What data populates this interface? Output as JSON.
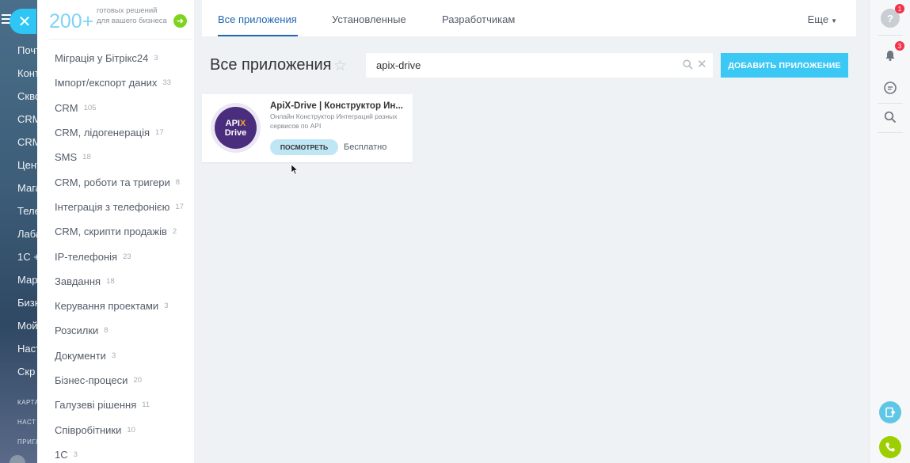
{
  "underlying_menu": {
    "items": [
      "Почт",
      "Конт",
      "Скво",
      "CRM",
      "CRM",
      "Цент",
      "Мага",
      "Теле",
      "Лаба",
      "1С +",
      "Мар",
      "Бизн",
      "Мой",
      "Наст",
      "Скр"
    ],
    "small_items": [
      "КАРТА",
      "НАСТ",
      "ПРИГЛ"
    ]
  },
  "promo": {
    "number": "200+",
    "text": "готовых решений для вашего бизнеса"
  },
  "categories": [
    {
      "label": "Міграція у Бітрікс24",
      "count": "3"
    },
    {
      "label": "Імпорт/експорт даних",
      "count": "33"
    },
    {
      "label": "CRM",
      "count": "105"
    },
    {
      "label": "CRM, лідогенерація",
      "count": "17"
    },
    {
      "label": "SMS",
      "count": "18"
    },
    {
      "label": "CRM, роботи та тригери",
      "count": "8"
    },
    {
      "label": "Інтеграція з телефонією",
      "count": "17"
    },
    {
      "label": "CRM, скрипти продажів",
      "count": "2"
    },
    {
      "label": "IP-телефонія",
      "count": "23"
    },
    {
      "label": "Завдання",
      "count": "18"
    },
    {
      "label": "Керування проектами",
      "count": "3"
    },
    {
      "label": "Розсилки",
      "count": "8"
    },
    {
      "label": "Документи",
      "count": "3"
    },
    {
      "label": "Бізнес-процеси",
      "count": "20"
    },
    {
      "label": "Галузеві рішення",
      "count": "11"
    },
    {
      "label": "Співробітники",
      "count": "10"
    },
    {
      "label": "1С",
      "count": "3"
    }
  ],
  "tabs": [
    {
      "label": "Все приложения",
      "active": true
    },
    {
      "label": "Установленные",
      "active": false
    },
    {
      "label": "Разработчикам",
      "active": false
    }
  ],
  "more_label": "Еще",
  "page_title": "Все приложения",
  "search": {
    "value": "apix-drive",
    "placeholder": ""
  },
  "add_button_label": "ДОБАВИТЬ ПРИЛОЖЕНИЕ",
  "app_card": {
    "name": "ApiX-Drive | Конструктор Ин...",
    "description": "Онлайн Конструктор Интеграций разных сервисов по API",
    "logo_line1_a": "API",
    "logo_line1_b": "X",
    "logo_line2": "Drive",
    "view_button": "ПОСМОТРЕТЬ",
    "price": "Бесплатно"
  },
  "right_panel": {
    "help_badge": "1",
    "notifications_badge": "3"
  },
  "colors": {
    "accent": "#2067b0",
    "add_button": "#3bc8f5",
    "close_button": "#2fc6f6",
    "promo_arrow": "#7ed321",
    "badge": "#f3334b",
    "logo_bg": "#4a2e7d"
  }
}
